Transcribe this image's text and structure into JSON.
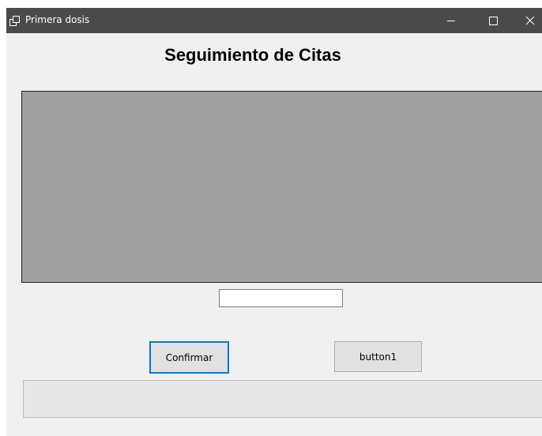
{
  "window": {
    "title": "Primera dosis",
    "controls": {
      "minimize": "minimize-icon",
      "maximize": "maximize-icon",
      "close": "close-icon"
    },
    "icon": "app-window-icon"
  },
  "main": {
    "heading": "Seguimiento de Citas",
    "text_input": {
      "value": "",
      "placeholder": ""
    },
    "buttons": {
      "confirm_label": "Confirmar",
      "button1_label": "button1"
    }
  },
  "colors": {
    "titlebar": "#4a4a4a",
    "form_background": "#f0f0f0",
    "panel": "#a0a0a0",
    "focus_border": "#0078d7"
  }
}
